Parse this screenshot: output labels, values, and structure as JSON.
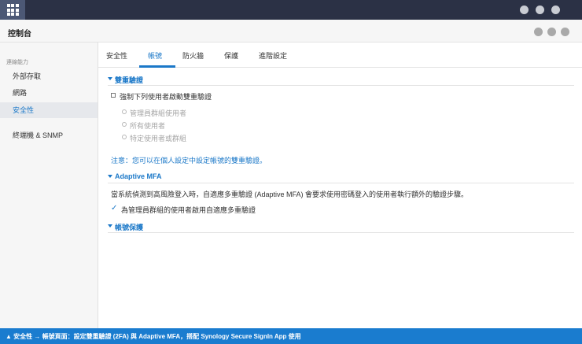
{
  "topbar": {
    "apps_icon": "grid-icon",
    "dots": [
      "dot",
      "dot",
      "dot"
    ]
  },
  "window": {
    "title": "控制台",
    "controls": [
      "circle",
      "circle",
      "circle"
    ]
  },
  "sidebar": {
    "group_label": "連線能力",
    "items": [
      {
        "label": "外部存取",
        "active": false
      },
      {
        "label": "網路",
        "active": false
      },
      {
        "label": "安全性",
        "active": true
      },
      {
        "label": "終端機 & SNMP",
        "active": false
      }
    ]
  },
  "tabs": [
    {
      "label": "安全性",
      "active": false
    },
    {
      "label": "帳號",
      "active": true
    },
    {
      "label": "防火牆",
      "active": false
    },
    {
      "label": "保護",
      "active": false
    },
    {
      "label": "進階設定",
      "active": false
    }
  ],
  "two_factor": {
    "header": "雙重驗證",
    "enforce_label": "強制下列使用者啟動雙重驗證",
    "enforce_checked": false,
    "options": [
      "管理員群組使用者",
      "所有使用者",
      "特定使用者或群組"
    ],
    "note": "注意：您可以在個人設定中設定帳號的雙重驗證。"
  },
  "adaptive_mfa": {
    "header": "Adaptive MFA",
    "description": "當系統偵測到高風險登入時，自適應多重驗證 (Adaptive MFA) 會要求使用密碼登入的使用者執行額外的驗證步驟。",
    "option_label": "為管理員群組的使用者啟用自適應多重驗證",
    "option_checked": true
  },
  "account_protection": {
    "header": "帳號保護"
  },
  "bottom_caption": "▲ 安全性 → 帳號頁面：設定雙重驗證 (2FA) 與 Adaptive MFA，搭配 Synology Secure SignIn App 使用",
  "colors": {
    "accent": "#1b78c8",
    "topbar": "#2b3145",
    "bottombar": "#1a7ccf"
  }
}
